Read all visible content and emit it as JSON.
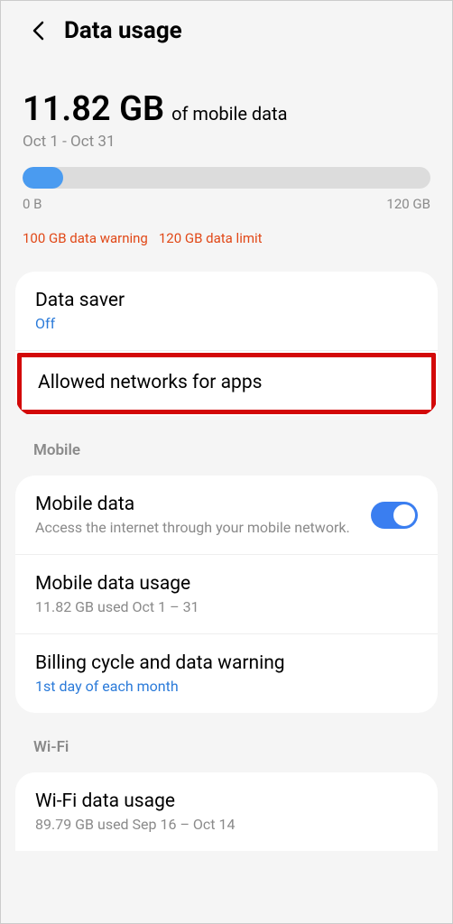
{
  "header": {
    "title": "Data usage"
  },
  "overview": {
    "amount": "11.82 GB",
    "label": "of mobile data",
    "period": "Oct 1 - Oct 31",
    "bar_min": "0 B",
    "bar_max": "120 GB",
    "warning_text": "100 GB data warning",
    "limit_text": "120 GB data limit",
    "fill_percent": 10
  },
  "card1": {
    "data_saver": {
      "title": "Data saver",
      "sub": "Off"
    },
    "allowed_networks": {
      "title": "Allowed networks for apps"
    }
  },
  "sections": {
    "mobile_label": "Mobile",
    "wifi_label": "Wi-Fi"
  },
  "mobile": {
    "mobile_data": {
      "title": "Mobile data",
      "sub": "Access the internet through your mobile network."
    },
    "usage": {
      "title": "Mobile data usage",
      "sub": "11.82 GB used Oct 1 – 31"
    },
    "billing": {
      "title": "Billing cycle and data warning",
      "sub": "1st day of each month"
    }
  },
  "wifi": {
    "usage": {
      "title": "Wi-Fi data usage",
      "sub": "89.79 GB used Sep 16 – Oct 14"
    }
  }
}
